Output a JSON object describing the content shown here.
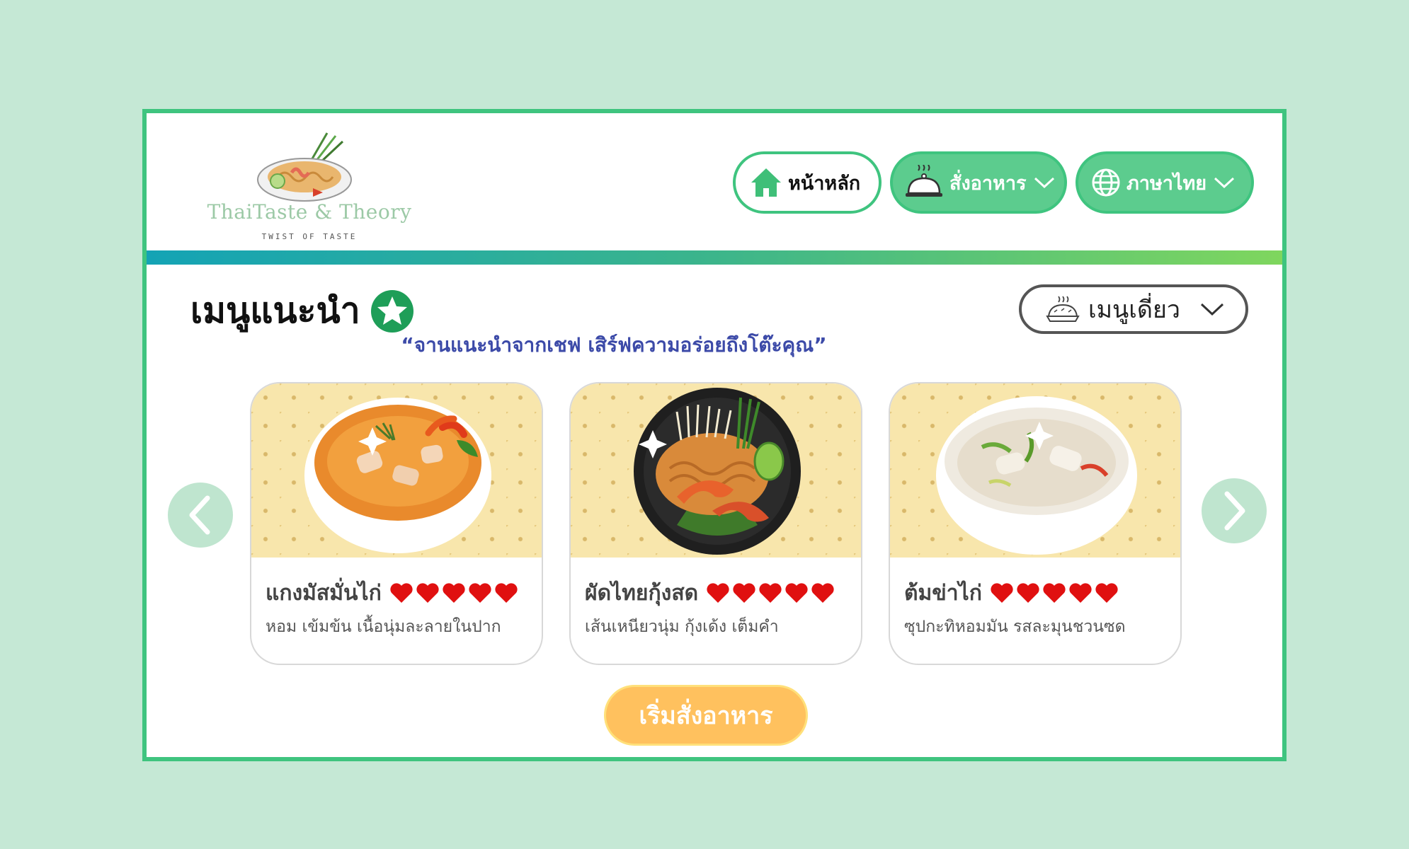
{
  "brand": {
    "name": "ThaiTaste & Theory",
    "tagline": "TWIST OF TASTE"
  },
  "nav": {
    "home_label": "หน้าหลัก",
    "order_label": "สั่งอาหาร",
    "language_label": "ภาษาไทย"
  },
  "section": {
    "title": "เมนูแนะนำ",
    "tagline": "“จานแนะนำจากเชฟ เสิร์ฟความอร่อยถึงโต๊ะคุณ”",
    "category_selected": "เมนูเดี่ยว"
  },
  "cards": [
    {
      "name": "แกงมัสมั่นไก่",
      "description": "หอม เข้มข้น เนื้อนุ่มละลายในปาก",
      "rating": 5
    },
    {
      "name": "ผัดไทยกุ้งสด",
      "description": "เส้นเหนียวนุ่ม กุ้งเด้ง เต็มคำ",
      "rating": 5
    },
    {
      "name": "ต้มข่าไก่",
      "description": "ซุปกะทิหอมมัน รสละมุนชวนซด",
      "rating": 5
    }
  ],
  "cta": {
    "label": "เริ่มสั่งอาหาร"
  },
  "colors": {
    "background": "#c5e8d5",
    "frame_border": "#3fc47f",
    "nav_green": "#5ccc8e",
    "tagline_blue": "#3c4aa8",
    "cta_orange": "#ffc15e",
    "heart_red": "#e01010"
  },
  "icons": {
    "home": "home-icon",
    "order": "food-cloche-icon",
    "language": "globe-icon",
    "category": "pie-icon",
    "title_badge": "star-badge-icon",
    "rating": "heart-icon"
  }
}
